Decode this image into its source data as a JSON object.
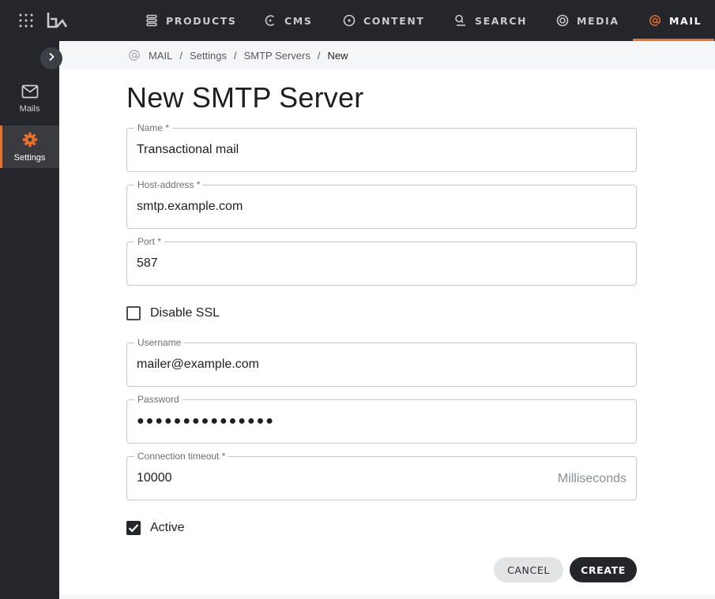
{
  "nav": {
    "items": [
      {
        "label": "PRODUCTS",
        "icon": "stack-icon"
      },
      {
        "label": "CMS",
        "icon": "cms-icon"
      },
      {
        "label": "CONTENT",
        "icon": "content-icon"
      },
      {
        "label": "SEARCH",
        "icon": "search-icon"
      },
      {
        "label": "MEDIA",
        "icon": "media-icon"
      },
      {
        "label": "MAIL",
        "icon": "at-icon",
        "active": true
      }
    ]
  },
  "sidebar": {
    "items": [
      {
        "label": "Mails",
        "icon": "mail-icon"
      },
      {
        "label": "Settings",
        "icon": "gear-icon",
        "active": true
      }
    ]
  },
  "breadcrumb": {
    "items": [
      "MAIL",
      "Settings",
      "SMTP Servers",
      "New"
    ]
  },
  "page": {
    "title": "New SMTP Server"
  },
  "form": {
    "name": {
      "label": "Name *",
      "value": "Transactional mail"
    },
    "host": {
      "label": "Host-address *",
      "value": "smtp.example.com"
    },
    "port": {
      "label": "Port *",
      "value": "587"
    },
    "disable_ssl": {
      "label": "Disable SSL",
      "checked": false
    },
    "username": {
      "label": "Username",
      "value": "mailer@example.com"
    },
    "password": {
      "label": "Password",
      "value": "●●●●●●●●●●●●●●●"
    },
    "timeout": {
      "label": "Connection timeout *",
      "value": "10000",
      "suffix": "Milliseconds"
    },
    "active": {
      "label": "Active",
      "checked": true
    }
  },
  "actions": {
    "cancel": "CANCEL",
    "create": "CREATE"
  },
  "colors": {
    "accent": "#e8712b",
    "dark": "#25262b"
  }
}
